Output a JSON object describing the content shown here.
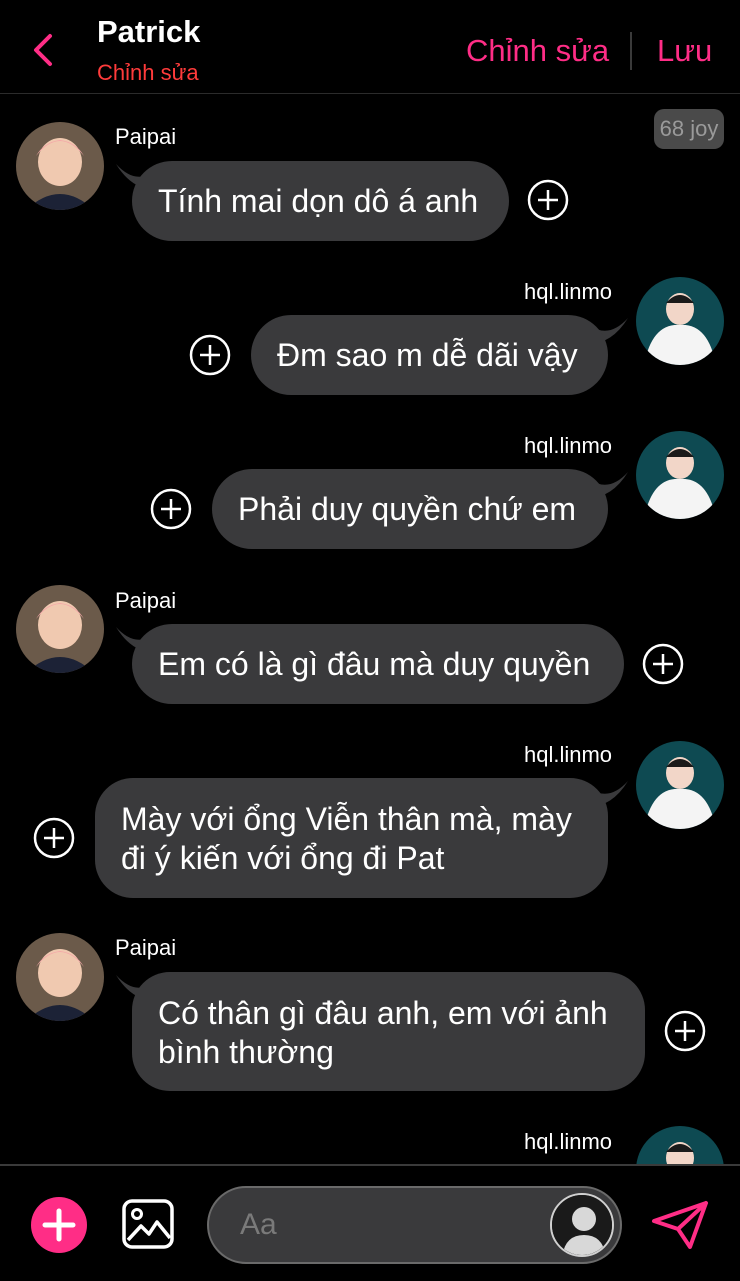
{
  "header": {
    "title": "Patrick",
    "subtitle": "Chỉnh sửa",
    "edit_label": "Chỉnh sửa",
    "save_label": "Lưu",
    "accent_color": "#ff2d86"
  },
  "badge": {
    "text": "68 joy"
  },
  "messages": [
    {
      "side": "left",
      "sender": "Paipai",
      "text": "Tính mai dọn dô á anh"
    },
    {
      "side": "right",
      "sender": "hql.linmo",
      "text": "Đm sao m dễ dãi vậy"
    },
    {
      "side": "right",
      "sender": "hql.linmo",
      "text": "Phải duy quyền chứ em"
    },
    {
      "side": "left",
      "sender": "Paipai",
      "text": "Em có là gì đâu mà duy quyền"
    },
    {
      "side": "right",
      "sender": "hql.linmo",
      "text": "Mày với ổng Viễn thân mà, mày đi ý kiến với ổng đi Pat"
    },
    {
      "side": "left",
      "sender": "Paipai",
      "text": "Có thân gì đâu anh, em với ảnh bình thường"
    },
    {
      "side": "right",
      "sender": "hql.linmo",
      "text": ""
    }
  ],
  "composer": {
    "placeholder": "Aa",
    "icons": [
      "plus-icon",
      "image-icon",
      "user-avatar-icon",
      "send-icon"
    ]
  }
}
